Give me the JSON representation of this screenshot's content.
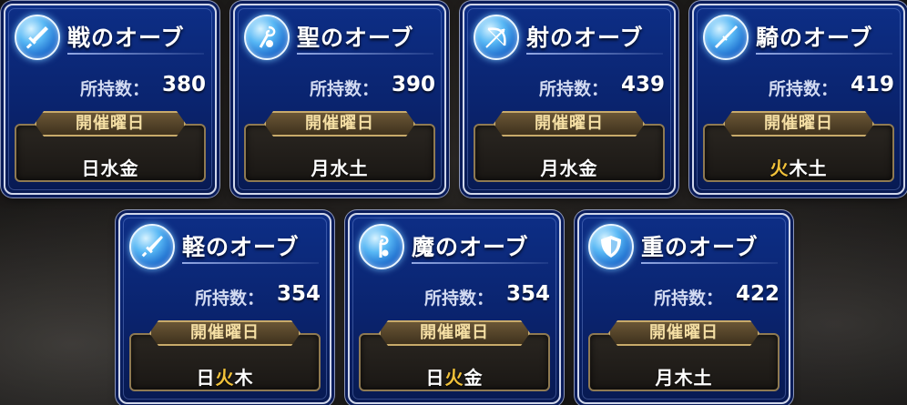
{
  "labels": {
    "count_label": "所持数：",
    "schedule_header": "開催曜日"
  },
  "colors": {
    "card_blue": "#0a236d",
    "highlight_day": "#f2c23a",
    "header_gold": "#f5dfa4"
  },
  "orbs": [
    {
      "title": "戦のオーブ",
      "icon": "sword-icon",
      "count": "380",
      "days": [
        {
          "d": "日",
          "hl": false
        },
        {
          "d": "水",
          "hl": false
        },
        {
          "d": "金",
          "hl": false
        }
      ]
    },
    {
      "title": "聖のオーブ",
      "icon": "staff-icon",
      "count": "390",
      "days": [
        {
          "d": "月",
          "hl": false
        },
        {
          "d": "水",
          "hl": false
        },
        {
          "d": "土",
          "hl": false
        }
      ]
    },
    {
      "title": "射のオーブ",
      "icon": "bow-icon",
      "count": "439",
      "days": [
        {
          "d": "月",
          "hl": false
        },
        {
          "d": "水",
          "hl": false
        },
        {
          "d": "金",
          "hl": false
        }
      ]
    },
    {
      "title": "騎のオーブ",
      "icon": "lance-icon",
      "count": "419",
      "days": [
        {
          "d": "火",
          "hl": true
        },
        {
          "d": "木",
          "hl": false
        },
        {
          "d": "土",
          "hl": false
        }
      ]
    },
    {
      "title": "軽のオーブ",
      "icon": "dagger-icon",
      "count": "354",
      "days": [
        {
          "d": "日",
          "hl": false
        },
        {
          "d": "火",
          "hl": true
        },
        {
          "d": "木",
          "hl": false
        }
      ]
    },
    {
      "title": "魔のオーブ",
      "icon": "magic-staff-icon",
      "count": "354",
      "days": [
        {
          "d": "日",
          "hl": false
        },
        {
          "d": "火",
          "hl": true
        },
        {
          "d": "金",
          "hl": false
        }
      ]
    },
    {
      "title": "重のオーブ",
      "icon": "shield-icon",
      "count": "422",
      "days": [
        {
          "d": "月",
          "hl": false
        },
        {
          "d": "木",
          "hl": false
        },
        {
          "d": "土",
          "hl": false
        }
      ]
    }
  ]
}
